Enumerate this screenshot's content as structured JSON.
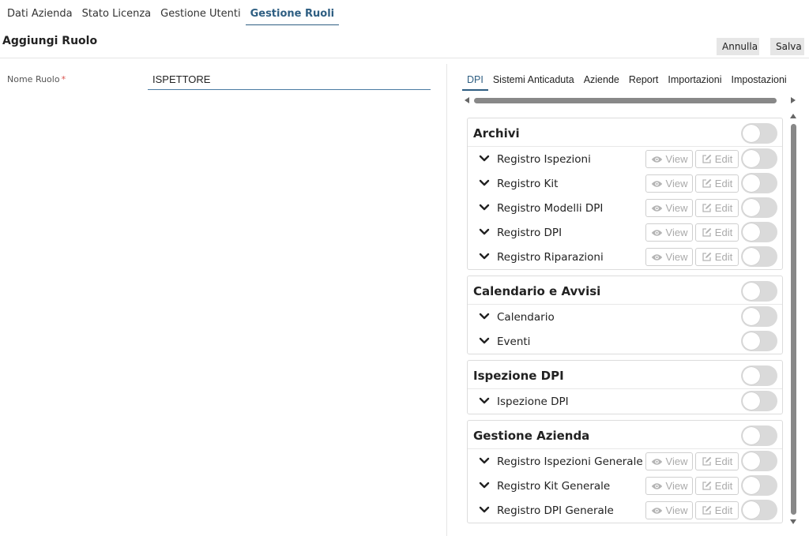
{
  "top_tabs": [
    {
      "label": "Dati Azienda",
      "active": false
    },
    {
      "label": "Stato Licenza",
      "active": false
    },
    {
      "label": "Gestione Utenti",
      "active": false
    },
    {
      "label": "Gestione Ruoli",
      "active": true
    }
  ],
  "page": {
    "title": "Aggiungi Ruolo",
    "cancel_label": "Annulla",
    "save_label": "Salva"
  },
  "form": {
    "name_label": "Nome Ruolo",
    "required_mark": "*",
    "name_value": "ISPETTORE"
  },
  "sub_tabs": [
    {
      "label": "DPI",
      "active": true
    },
    {
      "label": "Sistemi Anticaduta",
      "active": false
    },
    {
      "label": "Aziende",
      "active": false
    },
    {
      "label": "Report",
      "active": false
    },
    {
      "label": "Importazioni",
      "active": false
    },
    {
      "label": "Impostazioni",
      "active": false
    }
  ],
  "perm_labels": {
    "view": "View",
    "edit": "Edit"
  },
  "sections": [
    {
      "title": "Archivi",
      "rows": [
        {
          "label": "Registro Ispezioni",
          "buttons": true
        },
        {
          "label": "Registro Kit",
          "buttons": true
        },
        {
          "label": "Registro Modelli DPI",
          "buttons": true
        },
        {
          "label": "Registro DPI",
          "buttons": true
        },
        {
          "label": "Registro Riparazioni",
          "buttons": true
        }
      ]
    },
    {
      "title": "Calendario e Avvisi",
      "rows": [
        {
          "label": "Calendario",
          "buttons": false
        },
        {
          "label": "Eventi",
          "buttons": false
        }
      ]
    },
    {
      "title": "Ispezione DPI",
      "rows": [
        {
          "label": "Ispezione DPI",
          "buttons": false
        }
      ]
    },
    {
      "title": "Gestione Azienda",
      "rows": [
        {
          "label": "Registro Ispezioni Generale",
          "buttons": true
        },
        {
          "label": "Registro Kit Generale",
          "buttons": true
        },
        {
          "label": "Registro DPI Generale",
          "buttons": true
        }
      ]
    }
  ],
  "colors": {
    "accent": "#2e5e82",
    "required": "#d9534f",
    "toggle_off": "#dadada"
  },
  "icons": {
    "expand": "chevron-down-icon",
    "view": "eye-icon",
    "edit": "edit-icon"
  }
}
